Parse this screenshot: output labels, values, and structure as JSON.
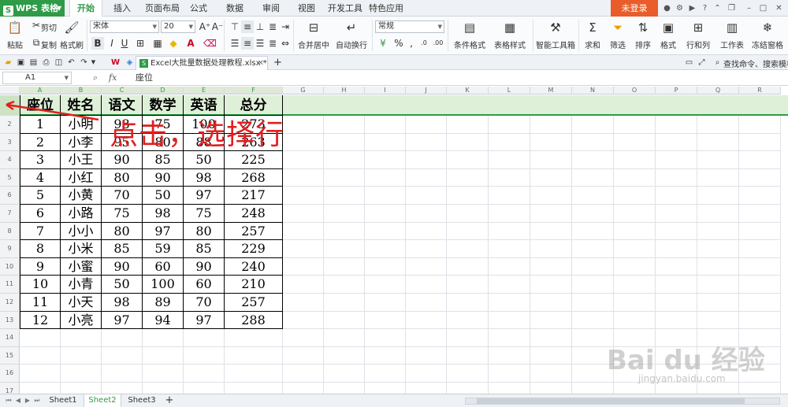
{
  "app": {
    "logo_label": "WPS 表格",
    "menu_tabs": [
      "开始",
      "插入",
      "页面布局",
      "公式",
      "数据",
      "审阅",
      "视图",
      "开发工具",
      "特色应用"
    ],
    "active_menu_tab": "开始",
    "login_label": "未登录"
  },
  "ribbon": {
    "paste": "粘贴",
    "cut": "剪切",
    "copy": "复制",
    "format_painter": "格式刷",
    "font_name": "宋体",
    "font_size": "20",
    "bold": "B",
    "italic": "I",
    "underline": "U",
    "merge_center": "合并居中",
    "wrap_text": "自动换行",
    "number_format": "常规",
    "conditional_format": "条件格式",
    "table_style": "表格样式",
    "smart_toolbox": "智能工具箱",
    "sum": "求和",
    "filter": "筛选",
    "sort": "排序",
    "format": "格式",
    "row_col": "行和列",
    "worksheet": "工作表",
    "freeze": "冻结窗格",
    "search_placeholder": "查找命令、搜索模板"
  },
  "document": {
    "tab_title": "Excel大批量数据处理教程.xlsx *"
  },
  "formula_bar": {
    "cell_ref": "A1",
    "fx": "fx",
    "content": "座位"
  },
  "grid": {
    "columns": [
      "A",
      "B",
      "C",
      "D",
      "E",
      "F",
      "G",
      "H",
      "I",
      "J",
      "K",
      "L",
      "M",
      "N",
      "O",
      "P",
      "Q",
      "R"
    ],
    "row_numbers": [
      "1",
      "2",
      "3",
      "4",
      "5",
      "6",
      "7",
      "8",
      "9",
      "10",
      "11",
      "12",
      "13",
      "14",
      "15",
      "16",
      "17"
    ],
    "headers": [
      "座位",
      "姓名",
      "语文",
      "数学",
      "英语",
      "总分"
    ],
    "rows": [
      [
        "1",
        "小明",
        "98",
        "75",
        "100",
        "273"
      ],
      [
        "2",
        "小李",
        "95",
        "80",
        "88",
        "263"
      ],
      [
        "3",
        "小王",
        "90",
        "85",
        "50",
        "225"
      ],
      [
        "4",
        "小红",
        "80",
        "90",
        "98",
        "268"
      ],
      [
        "5",
        "小黄",
        "70",
        "50",
        "97",
        "217"
      ],
      [
        "6",
        "小路",
        "75",
        "98",
        "75",
        "248"
      ],
      [
        "7",
        "小小",
        "80",
        "97",
        "80",
        "257"
      ],
      [
        "8",
        "小米",
        "85",
        "59",
        "85",
        "229"
      ],
      [
        "9",
        "小蜜",
        "90",
        "60",
        "90",
        "240"
      ],
      [
        "10",
        "小青",
        "50",
        "100",
        "60",
        "210"
      ],
      [
        "11",
        "小天",
        "98",
        "89",
        "70",
        "257"
      ],
      [
        "12",
        "小亮",
        "97",
        "94",
        "97",
        "288"
      ]
    ]
  },
  "annotation": "点击，选择行",
  "sheets": {
    "tabs": [
      "Sheet1",
      "Sheet2",
      "Sheet3"
    ],
    "active": "Sheet2",
    "add_label": "+"
  },
  "watermark": {
    "brand": "Bai du 经验",
    "url": "jingyan.baidu.com"
  },
  "colors": {
    "accent": "#2f9a47",
    "selection": "#dff0d8",
    "login": "#e85d2a",
    "annotation": "#e02020"
  }
}
